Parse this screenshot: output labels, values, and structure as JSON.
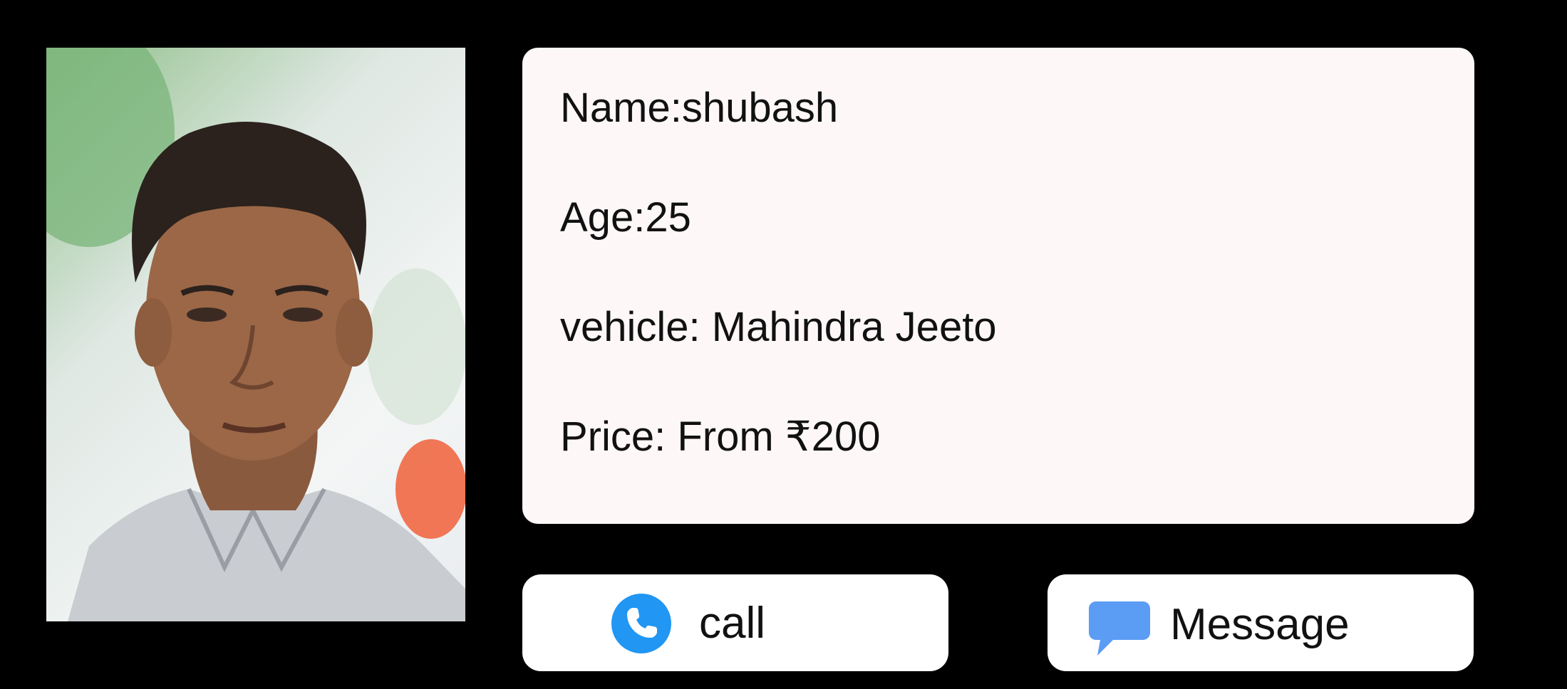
{
  "profile": {
    "photo_alt": "driver photo",
    "name_line": "Name:shubash",
    "age_line": "Age:25",
    "vehicle_line": "vehicle: Mahindra Jeeto",
    "price_line": "Price: From ₹200"
  },
  "actions": {
    "call_label": "call",
    "call_icon": "phone-icon",
    "call_icon_color": "#2196f3",
    "message_label": "Message",
    "message_icon": "chat-bubble-icon",
    "message_icon_color": "#5b9cf5"
  }
}
